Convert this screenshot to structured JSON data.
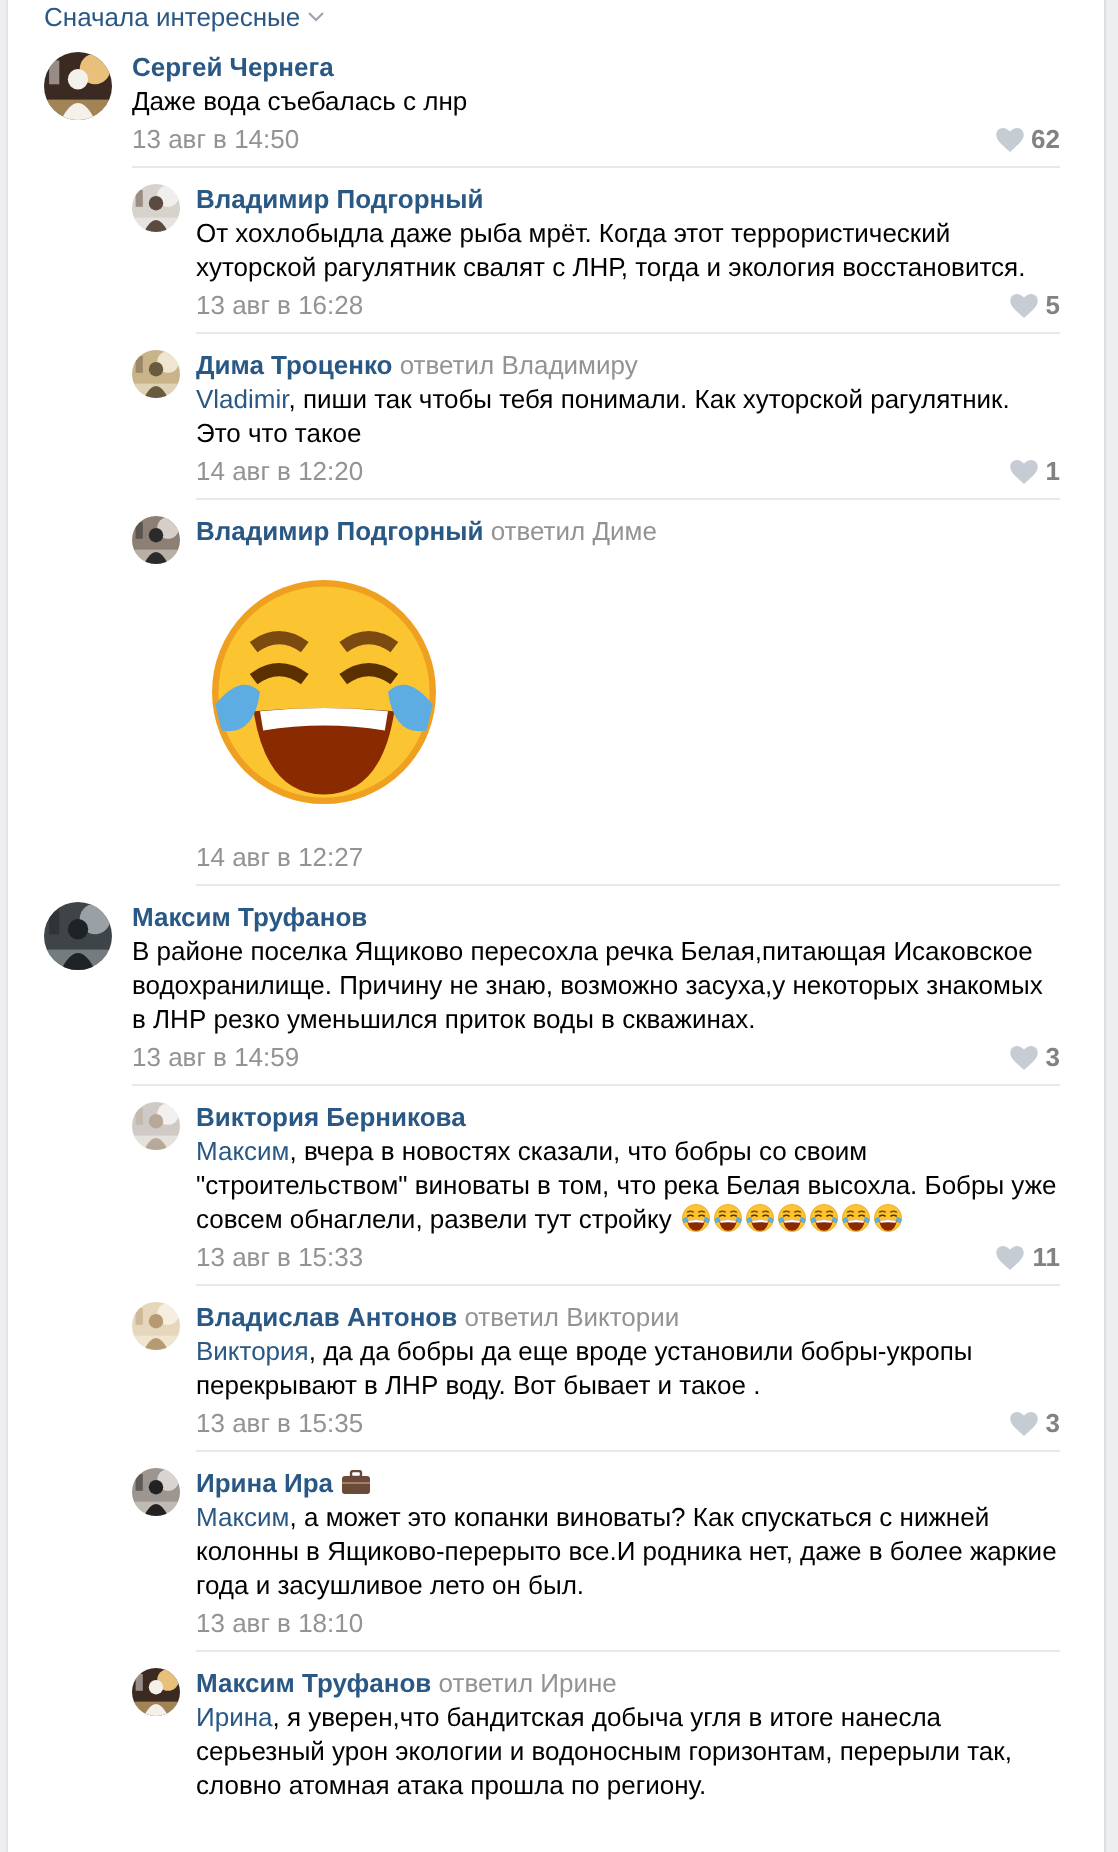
{
  "sort": {
    "label": "Сначала интересные"
  },
  "comments": [
    {
      "author": "Сергей Чернега",
      "text": "Даже вода съебалась с лнр",
      "date": "13 авг в 14:50",
      "likes": "62",
      "replies": [
        {
          "author": "Владимир Подгорный",
          "text": "От хохлобыдла даже рыба мрёт. Когда этот террористический хуторской рагулятник свалят с ЛНР, тогда и экология восстановится.",
          "date": "13 авг в 16:28",
          "likes": "5"
        },
        {
          "author": "Дима Троценко",
          "reply_to": "ответил Владимиру",
          "mention": "Vladimir",
          "text": ", пиши так чтобы тебя понимали. Как хуторской рагулятник. Это что такое",
          "date": "14 авг в 12:20",
          "likes": "1"
        },
        {
          "author": "Владимир Подгорный",
          "reply_to": "ответил Диме",
          "attachment": {
            "kind": "sticker"
          },
          "date": "14 авг в 12:27"
        }
      ]
    },
    {
      "author": "Максим Труфанов",
      "text": "В районе поселка Ящиково пересохла речка Белая,питающая Исаковское водохранилище. Причину не знаю, возможно засуха,у некоторых знакомых в ЛНР резко уменьшился приток воды в скважинах.",
      "date": "13 авг в 14:59",
      "likes": "3",
      "replies": [
        {
          "author": "Виктория Берникова",
          "mention": "Максим",
          "text": ", вчера в новостях сказали, что бобры со своим \"строительством\" виноваты в том, что река Белая высохла. Бобры уже совсем обнаглели, развели тут стройку",
          "emojis": [
            {
              "kind": "rofl"
            },
            {
              "kind": "rofl"
            },
            {
              "kind": "rofl"
            },
            {
              "kind": "rofl"
            },
            {
              "kind": "rofl"
            },
            {
              "kind": "rofl"
            },
            {
              "kind": "rofl"
            }
          ],
          "date": "13 авг в 15:33",
          "likes": "11"
        },
        {
          "author": "Владислав Антонов",
          "reply_to": "ответил Виктории",
          "mention": "Виктория",
          "text": ", да да бобры да еще вроде установили бобры-укропы перекрывают в ЛНР воду. Вот бывает и такое .",
          "date": "13 авг в 15:35",
          "likes": "3"
        },
        {
          "author": "Ирина Ира",
          "badge": {
            "kind": "briefcase"
          },
          "mention": "Максим",
          "text": ", а может это копанки виноваты? Как спускаться с нижней колонны в Ящиково-перерыто все.И родника нет, даже в более жаркие года и засушливое лето он был.",
          "date": "13 авг в 18:10"
        },
        {
          "author": "Максим Труфанов",
          "reply_to": "ответил Ирине",
          "mention": "Ирина",
          "text": ", я уверен,что бандитская добыча угля в итоге нанесла серьезный урон экологии и водоносным горизонтам, перерыли так, словно атомная атака прошла по региону."
        }
      ]
    }
  ]
}
